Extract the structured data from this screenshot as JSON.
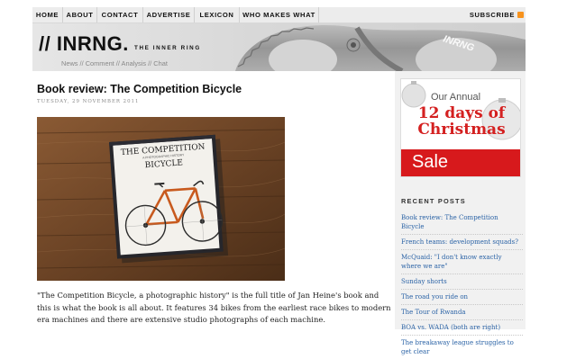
{
  "nav": {
    "items": [
      "HOME",
      "ABOUT",
      "CONTACT",
      "ADVERTISE",
      "LEXICON",
      "WHO MAKES WHAT"
    ],
    "subscribe_label": "SUBSCRIBE"
  },
  "header": {
    "logo": "// INRNG.",
    "tagline": "THE INNER RING",
    "subnav": "News // Comment // Analysis // Chat"
  },
  "post": {
    "title": "Book review: The Competition Bicycle",
    "date": "TUESDAY, 29 NOVEMBER 2011",
    "book_cover": {
      "title_line1": "THE COMPETITION",
      "subtitle": "A PHOTOGRAPHIC HISTORY",
      "title_line2": "BICYCLE"
    },
    "body": "\"The Competition Bicycle, a photographic history\" is the full title of Jan Heine's book and this is what the book is all about. It features 34 bikes from the earliest race bikes to modern era machines and there are extensive studio photographs of each machine."
  },
  "sidebar": {
    "promo": {
      "line1": "Our Annual",
      "line2": "12 days of Christmas",
      "sale": "Sale",
      "accent": "#d7191c"
    },
    "recent_title": "RECENT POSTS",
    "recent_posts": [
      "Book review: The Competition Bicycle",
      "French teams: development squads?",
      "McQuaid: \"I don't know exactly where we are\"",
      "Sunday shorts",
      "The road you ride on",
      "The Tour of Rwanda",
      "BOA vs. WADA (both are right)",
      "The breakaway league struggles to get clear"
    ],
    "link_color": "#2b63a6"
  }
}
